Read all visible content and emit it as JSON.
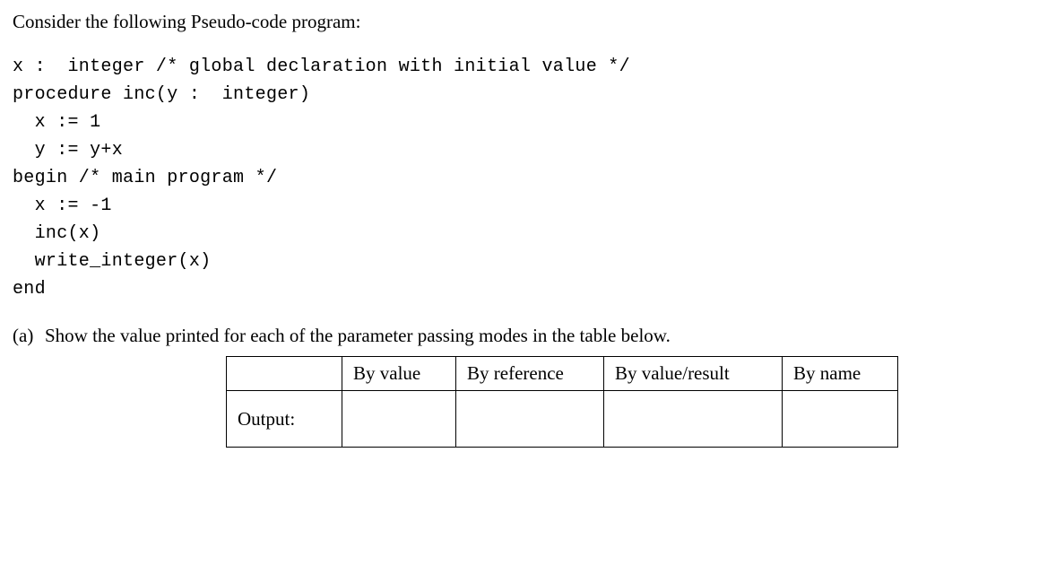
{
  "intro": "Consider the following Pseudo-code program:",
  "code": "x :  integer /* global declaration with initial value */\nprocedure inc(y :  integer)\n  x := 1\n  y := y+x\nbegin /* main program */\n  x := -1\n  inc(x)\n  write_integer(x)\nend",
  "part_a": {
    "label": "(a)",
    "text": "Show the value printed for each of the parameter passing modes in the table below."
  },
  "table": {
    "row_head_blank": "",
    "headers": {
      "by_value": "By value",
      "by_reference": "By reference",
      "by_value_result": "By value/result",
      "by_name": "By name"
    },
    "output_label": "Output:",
    "cells": {
      "by_value": "",
      "by_reference": "",
      "by_value_result": "",
      "by_name": ""
    }
  }
}
